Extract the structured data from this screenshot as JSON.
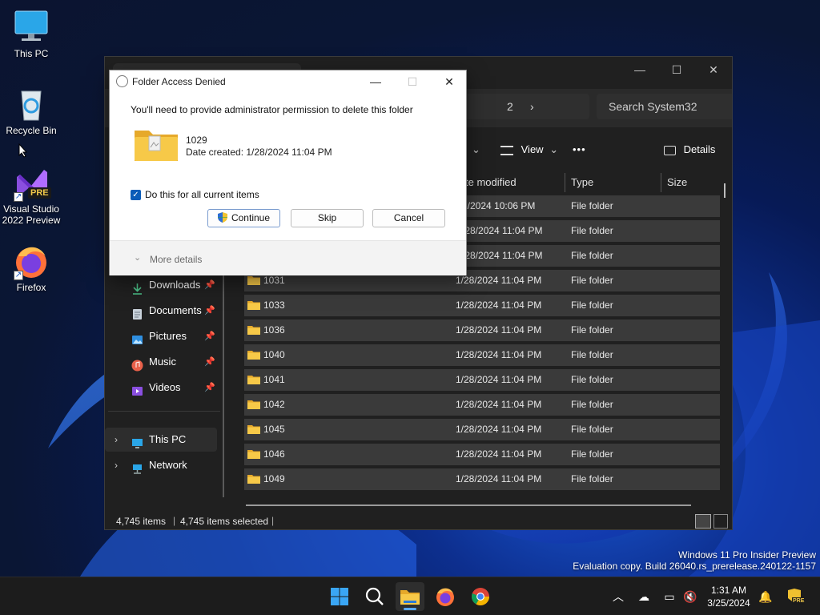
{
  "desktop": {
    "icons": [
      {
        "label": "This PC"
      },
      {
        "label": "Recycle Bin"
      },
      {
        "label": "Visual Studio 2022 Preview",
        "badge": "PRE"
      },
      {
        "label": "Firefox"
      }
    ],
    "watermark": {
      "line1": "Windows 11 Pro Insider Preview",
      "line2": "Evaluation copy. Build 26040.rs_prerelease.240122-1157"
    }
  },
  "explorer": {
    "address_tail": "2",
    "search_placeholder": "Search System32",
    "cmdbar": {
      "view": "View",
      "more": "•••",
      "details": "Details"
    },
    "columns": {
      "date_modified": "te modified",
      "type": "Type",
      "size": "Size"
    },
    "nav": [
      {
        "label": "Downloads",
        "pinned": true,
        "icon": "download-icon"
      },
      {
        "label": "Documents",
        "pinned": true,
        "icon": "documents-icon"
      },
      {
        "label": "Pictures",
        "pinned": true,
        "icon": "pictures-icon"
      },
      {
        "label": "Music",
        "pinned": true,
        "icon": "music-icon"
      },
      {
        "label": "Videos",
        "pinned": true,
        "icon": "videos-icon"
      },
      {
        "label": "This PC",
        "pinned": false,
        "icon": "this-pc-icon"
      },
      {
        "label": "Network",
        "pinned": false,
        "icon": "network-icon"
      }
    ],
    "rows": [
      {
        "name": "",
        "date": "2/2024 10:06 PM",
        "type": "File folder"
      },
      {
        "name": "",
        "date": "/28/2024 11:04 PM",
        "type": "File folder"
      },
      {
        "name": "",
        "date": "/28/2024 11:04 PM",
        "type": "File folder"
      },
      {
        "name": "1031",
        "date": "1/28/2024 11:04 PM",
        "type": "File folder"
      },
      {
        "name": "1033",
        "date": "1/28/2024 11:04 PM",
        "type": "File folder"
      },
      {
        "name": "1036",
        "date": "1/28/2024 11:04 PM",
        "type": "File folder"
      },
      {
        "name": "1040",
        "date": "1/28/2024 11:04 PM",
        "type": "File folder"
      },
      {
        "name": "1041",
        "date": "1/28/2024 11:04 PM",
        "type": "File folder"
      },
      {
        "name": "1042",
        "date": "1/28/2024 11:04 PM",
        "type": "File folder"
      },
      {
        "name": "1045",
        "date": "1/28/2024 11:04 PM",
        "type": "File folder"
      },
      {
        "name": "1046",
        "date": "1/28/2024 11:04 PM",
        "type": "File folder"
      },
      {
        "name": "1049",
        "date": "1/28/2024 11:04 PM",
        "type": "File folder"
      }
    ],
    "status": {
      "items": "4,745 items",
      "selected": "4,745 items selected"
    }
  },
  "dialog": {
    "title": "Folder Access Denied",
    "message": "You'll need to provide administrator permission to delete this folder",
    "folder_name": "1029",
    "folder_date": "Date created: 1/28/2024 11:04 PM",
    "checkbox_label": "Do this for all current items",
    "checkbox_checked": true,
    "buttons": {
      "continue": "Continue",
      "skip": "Skip",
      "cancel": "Cancel"
    },
    "more_details": "More details"
  },
  "taskbar": {
    "time": "1:31 AM",
    "date": "3/25/2024",
    "tray_badge": "PRE"
  },
  "colors": {
    "accent": "#0b5cb8",
    "folder": "#f7c948",
    "explorer_bg": "#202020"
  }
}
